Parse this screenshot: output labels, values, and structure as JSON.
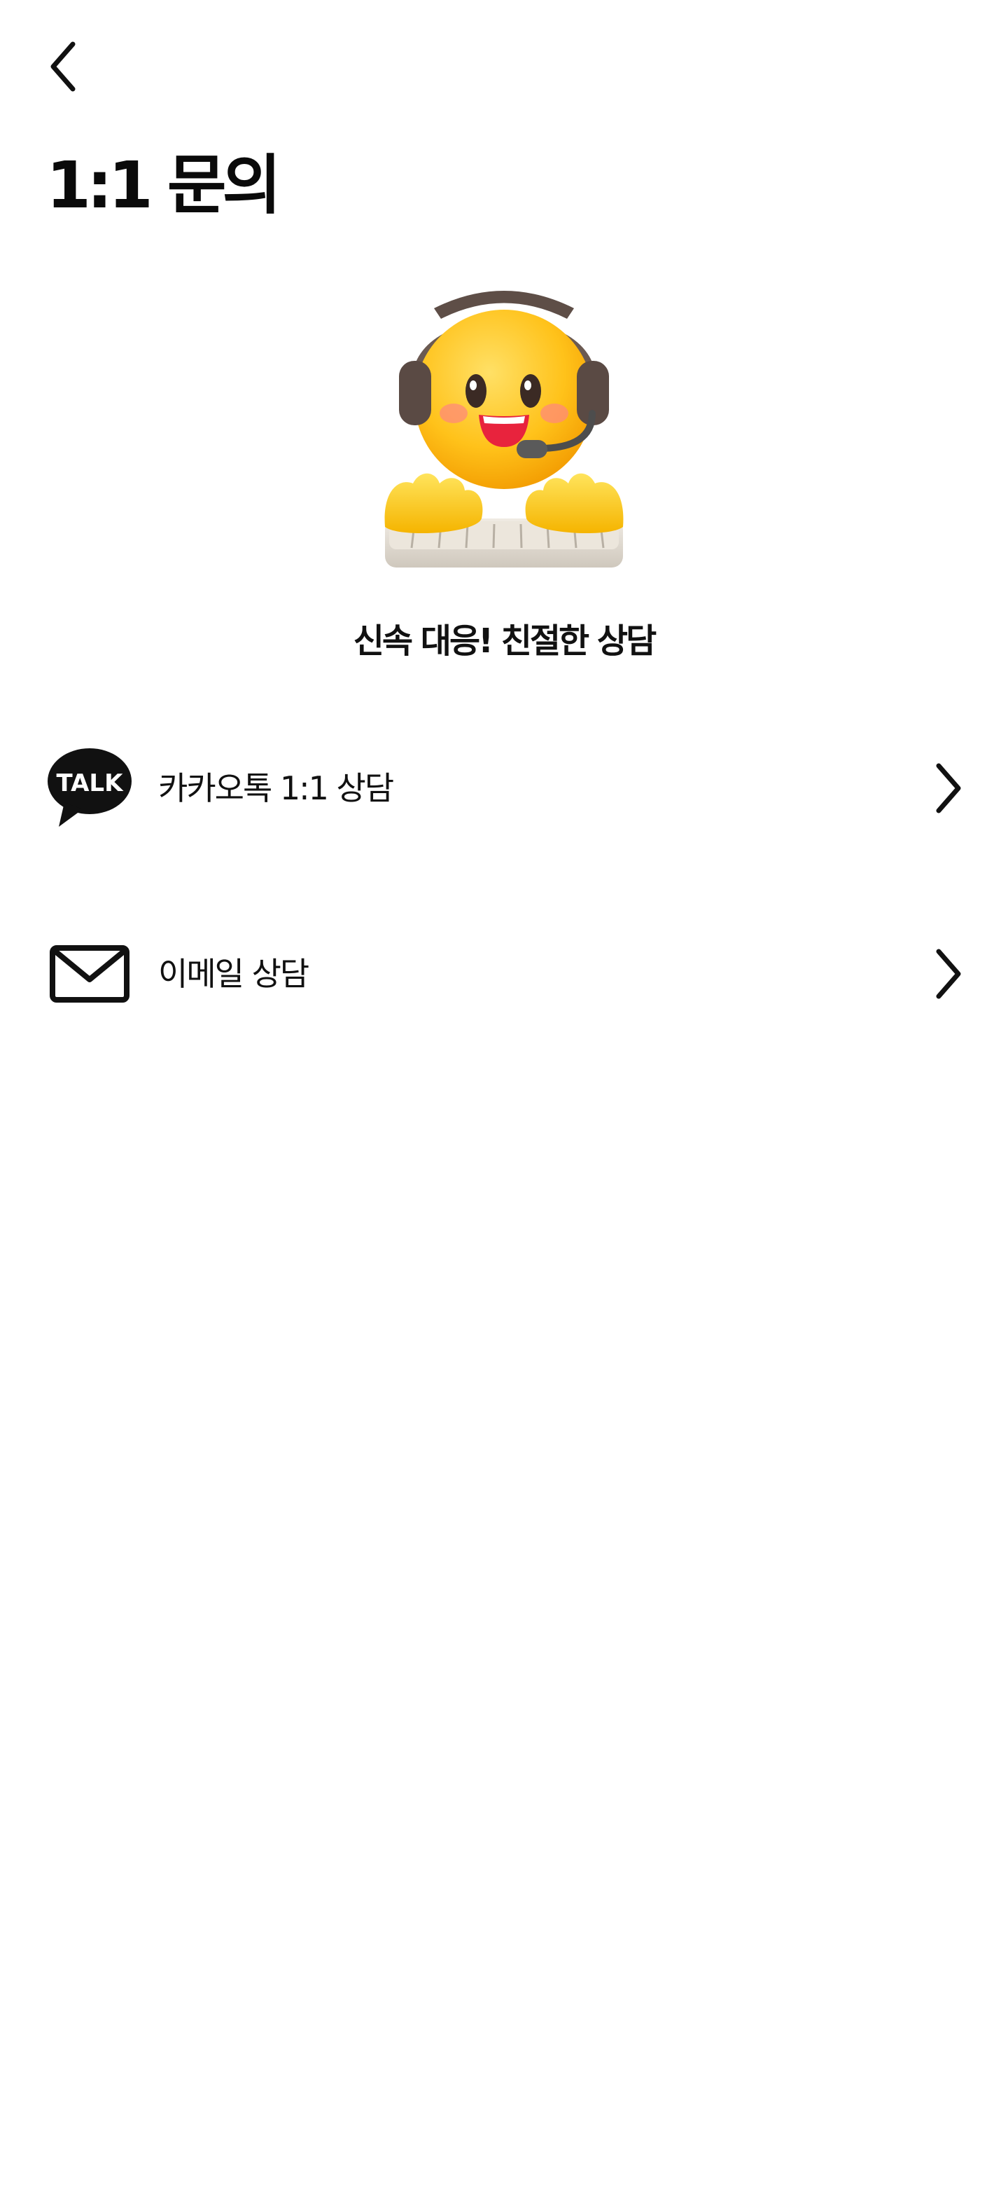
{
  "header": {
    "back_icon": "chevron-left-icon",
    "title": "1:1 문의"
  },
  "hero": {
    "image": "support-agent-emoji-with-headset-and-keyboard",
    "tagline": "신속 대응! 친절한 상담"
  },
  "menu": [
    {
      "icon": "kakaotalk-talk-bubble-icon",
      "icon_text": "TALK",
      "label": "카카오톡 1:1 상담",
      "chevron": "chevron-right-icon"
    },
    {
      "icon": "envelope-icon",
      "label": "이메일 상담",
      "chevron": "chevron-right-icon"
    }
  ]
}
